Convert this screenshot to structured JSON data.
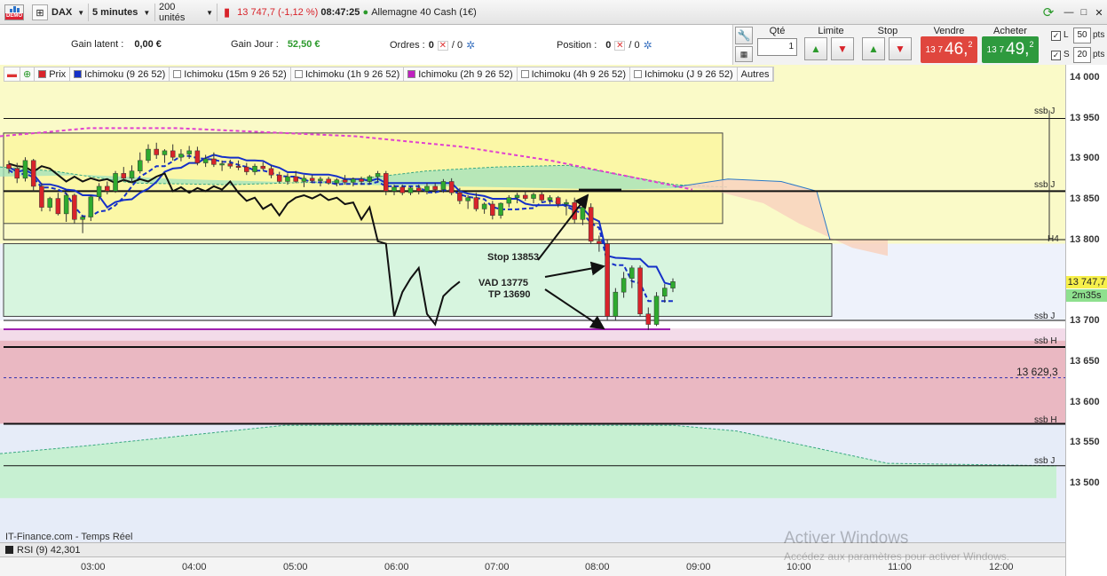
{
  "toolbar": {
    "demo_badge": "DEMO",
    "instrument": "DAX",
    "timeframe": "5 minutes",
    "units": "200 unités",
    "last_price": "13 747,7",
    "change": "(-1,12 %)",
    "time": "08:47:25",
    "market_name": "Allemagne 40 Cash (1€)"
  },
  "info": {
    "gain_latent_label": "Gain latent :",
    "gain_latent_value": "0,00 €",
    "gain_jour_label": "Gain Jour :",
    "gain_jour_value": "52,50 €",
    "ordres_label": "Ordres :",
    "ordres_a": "0",
    "ordres_b": "/ 0",
    "position_label": "Position :",
    "position_a": "0",
    "position_b": "/ 0"
  },
  "order_panel": {
    "qty_label": "Qté",
    "qty_value": "1",
    "limite_label": "Limite",
    "stop_label": "Stop",
    "sell_label": "Vendre",
    "buy_label": "Acheter",
    "sell_small": "13 7",
    "sell_big": "46,",
    "sell_sup": "2",
    "buy_small": "13 7",
    "buy_big": "49,",
    "buy_sup": "2",
    "l_label": "L",
    "l_value": "50",
    "s_label": "S",
    "s_value": "20",
    "pts": "pts"
  },
  "legend": [
    {
      "label": "Prix",
      "color": "#d8232a"
    },
    {
      "label": "Ichimoku (9 26 52)",
      "color": "#1530c8"
    },
    {
      "label": "Ichimoku (15m 9 26 52)",
      "color": "#ffffff"
    },
    {
      "label": "Ichimoku (1h 9 26 52)",
      "color": "#ffffff"
    },
    {
      "label": "Ichimoku (2h 9 26 52)",
      "color": "#c020c0"
    },
    {
      "label": "Ichimoku (4h 9 26 52)",
      "color": "#ffffff"
    },
    {
      "label": "Ichimoku (J 9 26 52)",
      "color": "#ffffff"
    },
    {
      "label": "Autres",
      "color": ""
    }
  ],
  "price_axis": [
    "14 000",
    "13 950",
    "13 900",
    "13 850",
    "13 800",
    "13 750",
    "13 700",
    "13 650",
    "13 600",
    "13 550",
    "13 500"
  ],
  "level_labels": {
    "ssb_j_1": "ssb J",
    "ssb_j_2": "ssb J",
    "h4": "H4",
    "ssb_j_3": "ssb J",
    "ssb_h_1": "ssb H",
    "level_value": "13 629,3",
    "ssb_h_2": "ssb H",
    "ssb_j_4": "ssb J"
  },
  "price_tag": "13 747,7",
  "countdown": "2m35s",
  "annotations": {
    "stop": "Stop 13853",
    "vad": "VAD 13775",
    "tp": "TP 13690"
  },
  "time_axis": [
    "03:00",
    "04:00",
    "05:00",
    "06:00",
    "07:00",
    "08:00",
    "09:00",
    "10:00",
    "11:00",
    "12:00"
  ],
  "source": "IT-Finance.com - Temps Réel",
  "rsi": "RSI (9) 42,301",
  "watermark": {
    "line1": "Activer Windows",
    "line2": "Accédez aux paramètres pour activer Windows."
  },
  "colors": {
    "up": "#2eaa2e",
    "down": "#d8232a",
    "kijun": "#1530c8",
    "chikou": "#111111",
    "magenta": "#e040d0",
    "purple": "#a020b0"
  },
  "candles": [
    {
      "o": 13893,
      "h": 13898,
      "l": 13882,
      "c": 13888
    },
    {
      "o": 13888,
      "h": 13895,
      "l": 13870,
      "c": 13876
    },
    {
      "o": 13876,
      "h": 13902,
      "l": 13872,
      "c": 13898
    },
    {
      "o": 13898,
      "h": 13900,
      "l": 13860,
      "c": 13866
    },
    {
      "o": 13866,
      "h": 13870,
      "l": 13835,
      "c": 13840
    },
    {
      "o": 13840,
      "h": 13853,
      "l": 13835,
      "c": 13851
    },
    {
      "o": 13851,
      "h": 13858,
      "l": 13830,
      "c": 13832
    },
    {
      "o": 13832,
      "h": 13858,
      "l": 13822,
      "c": 13855
    },
    {
      "o": 13855,
      "h": 13857,
      "l": 13820,
      "c": 13825
    },
    {
      "o": 13825,
      "h": 13830,
      "l": 13808,
      "c": 13828
    },
    {
      "o": 13828,
      "h": 13855,
      "l": 13823,
      "c": 13853
    },
    {
      "o": 13853,
      "h": 13870,
      "l": 13848,
      "c": 13866
    },
    {
      "o": 13866,
      "h": 13872,
      "l": 13856,
      "c": 13860
    },
    {
      "o": 13860,
      "h": 13885,
      "l": 13858,
      "c": 13882
    },
    {
      "o": 13882,
      "h": 13890,
      "l": 13872,
      "c": 13876
    },
    {
      "o": 13876,
      "h": 13892,
      "l": 13870,
      "c": 13885
    },
    {
      "o": 13885,
      "h": 13908,
      "l": 13882,
      "c": 13898
    },
    {
      "o": 13898,
      "h": 13918,
      "l": 13895,
      "c": 13912
    },
    {
      "o": 13912,
      "h": 13920,
      "l": 13900,
      "c": 13905
    },
    {
      "o": 13905,
      "h": 13912,
      "l": 13895,
      "c": 13910
    },
    {
      "o": 13910,
      "h": 13918,
      "l": 13898,
      "c": 13902
    },
    {
      "o": 13902,
      "h": 13912,
      "l": 13897,
      "c": 13906
    },
    {
      "o": 13906,
      "h": 13916,
      "l": 13900,
      "c": 13910
    },
    {
      "o": 13910,
      "h": 13915,
      "l": 13892,
      "c": 13895
    },
    {
      "o": 13895,
      "h": 13905,
      "l": 13890,
      "c": 13900
    },
    {
      "o": 13900,
      "h": 13908,
      "l": 13890,
      "c": 13893
    },
    {
      "o": 13893,
      "h": 13898,
      "l": 13885,
      "c": 13894
    },
    {
      "o": 13894,
      "h": 13899,
      "l": 13888,
      "c": 13891
    },
    {
      "o": 13891,
      "h": 13898,
      "l": 13886,
      "c": 13890
    },
    {
      "o": 13890,
      "h": 13895,
      "l": 13880,
      "c": 13884
    },
    {
      "o": 13884,
      "h": 13894,
      "l": 13880,
      "c": 13891
    },
    {
      "o": 13891,
      "h": 13896,
      "l": 13886,
      "c": 13888
    },
    {
      "o": 13888,
      "h": 13892,
      "l": 13876,
      "c": 13880
    },
    {
      "o": 13880,
      "h": 13884,
      "l": 13870,
      "c": 13872
    },
    {
      "o": 13872,
      "h": 13882,
      "l": 13868,
      "c": 13878
    },
    {
      "o": 13878,
      "h": 13885,
      "l": 13870,
      "c": 13872
    },
    {
      "o": 13872,
      "h": 13880,
      "l": 13865,
      "c": 13876
    },
    {
      "o": 13876,
      "h": 13880,
      "l": 13870,
      "c": 13873
    },
    {
      "o": 13873,
      "h": 13878,
      "l": 13866,
      "c": 13875
    },
    {
      "o": 13875,
      "h": 13878,
      "l": 13868,
      "c": 13870
    },
    {
      "o": 13870,
      "h": 13876,
      "l": 13866,
      "c": 13874
    },
    {
      "o": 13874,
      "h": 13880,
      "l": 13868,
      "c": 13871
    },
    {
      "o": 13871,
      "h": 13877,
      "l": 13866,
      "c": 13875
    },
    {
      "o": 13875,
      "h": 13878,
      "l": 13868,
      "c": 13872
    },
    {
      "o": 13872,
      "h": 13880,
      "l": 13868,
      "c": 13878
    },
    {
      "o": 13878,
      "h": 13885,
      "l": 13872,
      "c": 13882
    },
    {
      "o": 13882,
      "h": 13885,
      "l": 13855,
      "c": 13860
    },
    {
      "o": 13860,
      "h": 13868,
      "l": 13855,
      "c": 13865
    },
    {
      "o": 13865,
      "h": 13868,
      "l": 13855,
      "c": 13858
    },
    {
      "o": 13858,
      "h": 13866,
      "l": 13855,
      "c": 13864
    },
    {
      "o": 13864,
      "h": 13868,
      "l": 13856,
      "c": 13860
    },
    {
      "o": 13860,
      "h": 13870,
      "l": 13856,
      "c": 13866
    },
    {
      "o": 13866,
      "h": 13870,
      "l": 13858,
      "c": 13862
    },
    {
      "o": 13862,
      "h": 13875,
      "l": 13858,
      "c": 13872
    },
    {
      "o": 13872,
      "h": 13876,
      "l": 13855,
      "c": 13858
    },
    {
      "o": 13858,
      "h": 13864,
      "l": 13844,
      "c": 13848
    },
    {
      "o": 13848,
      "h": 13855,
      "l": 13838,
      "c": 13852
    },
    {
      "o": 13852,
      "h": 13858,
      "l": 13835,
      "c": 13838
    },
    {
      "o": 13838,
      "h": 13846,
      "l": 13832,
      "c": 13844
    },
    {
      "o": 13844,
      "h": 13848,
      "l": 13825,
      "c": 13830
    },
    {
      "o": 13830,
      "h": 13846,
      "l": 13826,
      "c": 13845
    },
    {
      "o": 13845,
      "h": 13855,
      "l": 13840,
      "c": 13852
    },
    {
      "o": 13852,
      "h": 13858,
      "l": 13845,
      "c": 13855
    },
    {
      "o": 13855,
      "h": 13860,
      "l": 13848,
      "c": 13851
    },
    {
      "o": 13851,
      "h": 13858,
      "l": 13845,
      "c": 13856
    },
    {
      "o": 13856,
      "h": 13860,
      "l": 13846,
      "c": 13849
    },
    {
      "o": 13849,
      "h": 13855,
      "l": 13844,
      "c": 13852
    },
    {
      "o": 13852,
      "h": 13854,
      "l": 13840,
      "c": 13844
    },
    {
      "o": 13844,
      "h": 13850,
      "l": 13830,
      "c": 13846
    },
    {
      "o": 13846,
      "h": 13852,
      "l": 13820,
      "c": 13825
    },
    {
      "o": 13825,
      "h": 13845,
      "l": 13818,
      "c": 13840
    },
    {
      "o": 13840,
      "h": 13845,
      "l": 13795,
      "c": 13798
    },
    {
      "o": 13798,
      "h": 13805,
      "l": 13785,
      "c": 13795
    },
    {
      "o": 13795,
      "h": 13800,
      "l": 13700,
      "c": 13705
    },
    {
      "o": 13705,
      "h": 13740,
      "l": 13700,
      "c": 13735
    },
    {
      "o": 13735,
      "h": 13760,
      "l": 13728,
      "c": 13752
    },
    {
      "o": 13752,
      "h": 13768,
      "l": 13740,
      "c": 13765
    },
    {
      "o": 13765,
      "h": 13768,
      "l": 13705,
      "c": 13708
    },
    {
      "o": 13708,
      "h": 13716,
      "l": 13688,
      "c": 13695
    },
    {
      "o": 13695,
      "h": 13735,
      "l": 13693,
      "c": 13730
    },
    {
      "o": 13730,
      "h": 13745,
      "l": 13722,
      "c": 13740
    },
    {
      "o": 13740,
      "h": 13752,
      "l": 13735,
      "c": 13748
    }
  ]
}
